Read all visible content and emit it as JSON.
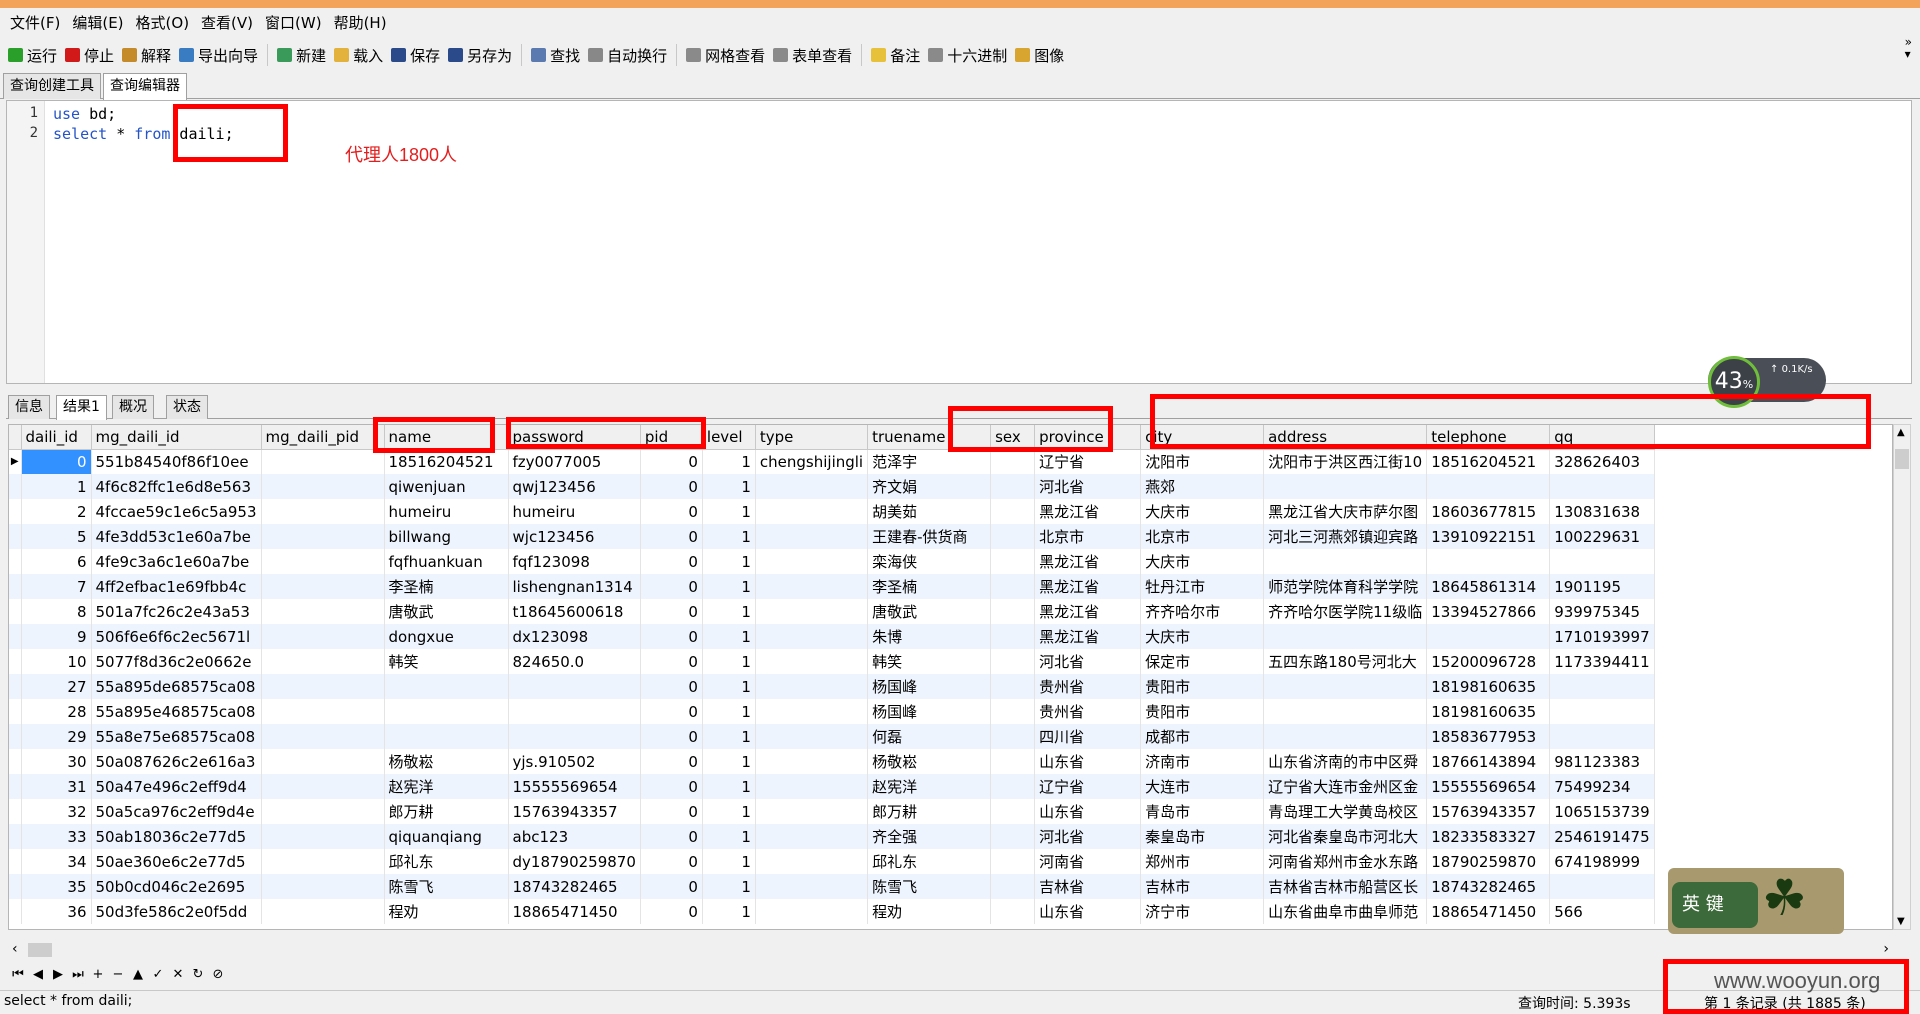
{
  "menu": [
    "文件(F)",
    "编辑(E)",
    "格式(O)",
    "查看(V)",
    "窗口(W)",
    "帮助(H)"
  ],
  "toolbar": {
    "groups": [
      [
        {
          "label": "运行",
          "icon": "run-icon",
          "color": "#2aa02a"
        },
        {
          "label": "停止",
          "icon": "stop-icon",
          "color": "#d21919"
        },
        {
          "label": "解释",
          "icon": "explain-icon",
          "color": "#c58a2a"
        },
        {
          "label": "导出向导",
          "icon": "export-icon",
          "color": "#3a7cc2"
        }
      ],
      [
        {
          "label": "新建",
          "icon": "new-icon",
          "color": "#3a9a5a"
        },
        {
          "label": "载入",
          "icon": "load-icon",
          "color": "#e3b23c"
        },
        {
          "label": "保存",
          "icon": "save-icon",
          "color": "#2a4a8a"
        },
        {
          "label": "另存为",
          "icon": "save-as-icon",
          "color": "#2a4a8a"
        }
      ],
      [
        {
          "label": "查找",
          "icon": "find-icon",
          "color": "#5a7ab0"
        },
        {
          "label": "自动换行",
          "icon": "wrap-icon",
          "color": "#888888"
        }
      ],
      [
        {
          "label": "网格查看",
          "icon": "grid-icon",
          "color": "#8a8a8a"
        },
        {
          "label": "表单查看",
          "icon": "form-icon",
          "color": "#8a8a8a"
        }
      ],
      [
        {
          "label": "备注",
          "icon": "note-icon",
          "color": "#e8c13a"
        },
        {
          "label": "十六进制",
          "icon": "hex-icon",
          "color": "#8a8a8a"
        },
        {
          "label": "图像",
          "icon": "image-icon",
          "color": "#d9a531"
        }
      ]
    ]
  },
  "top_tabs": [
    "查询创建工具",
    "查询编辑器"
  ],
  "editor": {
    "lines": [
      {
        "n": "1",
        "kw": "use",
        "rest": " bd;"
      },
      {
        "n": "2",
        "kw": "select",
        "rest": " * ",
        "kw2": "from",
        "rest2": " daili;"
      }
    ],
    "annotation": "代理人1800人"
  },
  "result_tabs": [
    "信息",
    "结果1",
    "概况",
    "状态"
  ],
  "grid": {
    "columns": [
      "daili_id",
      "mg_daili_id",
      "mg_daili_pid",
      "name",
      "password",
      "pid",
      "level",
      "type",
      "truename",
      "sex",
      "province",
      "city",
      "address",
      "telephone",
      "qq"
    ],
    "rows": [
      [
        "0",
        "551b84540f86f10ee",
        "",
        "18516204521",
        "fzy0077005",
        "0",
        "1",
        "chengshijingli",
        "范泽宇",
        "",
        "辽宁省",
        "沈阳市",
        "沈阳市于洪区西江街10",
        "18516204521",
        "328626403"
      ],
      [
        "1",
        "4f6c82ffc1e6d8e563",
        "",
        "qiwenjuan",
        "qwj123456",
        "0",
        "1",
        "",
        "齐文娟",
        "",
        "河北省",
        "燕郊",
        "",
        "",
        ""
      ],
      [
        "2",
        "4fccae59c1e6c5a953",
        "",
        "humeiru",
        "humeiru",
        "0",
        "1",
        "",
        "胡美茹",
        "",
        "黑龙江省",
        "大庆市",
        "黑龙江省大庆市萨尔图",
        "18603677815",
        "130831638"
      ],
      [
        "5",
        "4fe3dd53c1e60a7be",
        "",
        "billwang",
        "wjc123456",
        "0",
        "1",
        "",
        "王建春-供货商",
        "",
        "北京市",
        "北京市",
        "河北三河燕郊镇迎宾路",
        "13910922151",
        "100229631"
      ],
      [
        "6",
        "4fe9c3a6c1e60a7be",
        "",
        "fqfhuankuan",
        "fqf123098",
        "0",
        "1",
        "",
        "栾海侠",
        "",
        "黑龙江省",
        "大庆市",
        "",
        "",
        ""
      ],
      [
        "7",
        "4ff2efbac1e69fbb4c",
        "",
        "李圣楠",
        "lishengnan1314",
        "0",
        "1",
        "",
        "李圣楠",
        "",
        "黑龙江省",
        "牡丹江市",
        "师范学院体育科学学院",
        "18645861314",
        "1901195"
      ],
      [
        "8",
        "501a7fc26c2e43a53",
        "",
        "唐敬武",
        "t18645600618",
        "0",
        "1",
        "",
        "唐敬武",
        "",
        "黑龙江省",
        "齐齐哈尔市",
        "齐齐哈尔医学院11级临",
        "13394527866",
        "939975345"
      ],
      [
        "9",
        "506f6e6f6c2ec5671l",
        "",
        "dongxue",
        "dx123098",
        "0",
        "1",
        "",
        "朱博",
        "",
        "黑龙江省",
        "大庆市",
        "",
        "",
        "1710193997"
      ],
      [
        "10",
        "5077f8d36c2e0662e",
        "",
        "韩笑",
        "824650.0",
        "0",
        "1",
        "",
        "韩笑",
        "",
        "河北省",
        "保定市",
        "五四东路180号河北大",
        "15200096728",
        "1173394411"
      ],
      [
        "27",
        "55a895de68575ca08",
        "",
        "",
        "",
        "0",
        "1",
        "",
        "杨国峰",
        "",
        "贵州省",
        "贵阳市",
        "",
        "18198160635",
        ""
      ],
      [
        "28",
        "55a895e468575ca08",
        "",
        "",
        "",
        "0",
        "1",
        "",
        "杨国峰",
        "",
        "贵州省",
        "贵阳市",
        "",
        "18198160635",
        ""
      ],
      [
        "29",
        "55a8e75e68575ca08",
        "",
        "",
        "",
        "0",
        "1",
        "",
        "何磊",
        "",
        "四川省",
        "成都市",
        "",
        "18583677953",
        ""
      ],
      [
        "30",
        "50a087626c2e616a3",
        "",
        "杨敬崧",
        "yjs.910502",
        "0",
        "1",
        "",
        "杨敬崧",
        "",
        "山东省",
        "济南市",
        "山东省济南的市中区舜",
        "18766143894",
        "981123383"
      ],
      [
        "31",
        "50a47e496c2eff9d4",
        "",
        "赵宪洋",
        "15555569654",
        "0",
        "1",
        "",
        "赵宪洋",
        "",
        "辽宁省",
        "大连市",
        "辽宁省大连市金州区金",
        "15555569654",
        "75499234"
      ],
      [
        "32",
        "50a5ca976c2eff9d4e",
        "",
        "郎万耕",
        "15763943357",
        "0",
        "1",
        "",
        "郎万耕",
        "",
        "山东省",
        "青岛市",
        "青岛理工大学黄岛校区",
        "15763943357",
        "1065153739"
      ],
      [
        "33",
        "50ab18036c2e77d5",
        "",
        "qiquanqiang",
        "abc123",
        "0",
        "1",
        "",
        "齐全强",
        "",
        "河北省",
        "秦皇岛市",
        "河北省秦皇岛市河北大",
        "18233583327",
        "2546191475"
      ],
      [
        "34",
        "50ae360e6c2e77d5",
        "",
        "邱礼东",
        "dy18790259870",
        "0",
        "1",
        "",
        "邱礼东",
        "",
        "河南省",
        "郑州市",
        "河南省郑州市金水东路",
        "18790259870",
        "674198999"
      ],
      [
        "35",
        "50b0cd046c2e2695",
        "",
        "陈雪飞",
        "18743282465",
        "0",
        "1",
        "",
        "陈雪飞",
        "",
        "吉林省",
        "吉林市",
        "吉林省吉林市船营区长",
        "18743282465",
        ""
      ],
      [
        "36",
        "50d3fe586c2e0f5dd",
        "",
        "程劝",
        "18865471450",
        "0",
        "1",
        "",
        "程劝",
        "",
        "山东省",
        "济宁市",
        "山东省曲阜市曲阜师范",
        "18865471450",
        "566"
      ]
    ]
  },
  "nav_buttons": [
    {
      "glyph": "⏮",
      "icon": "first-record-icon"
    },
    {
      "glyph": "◀",
      "icon": "prev-record-icon"
    },
    {
      "glyph": "▶",
      "icon": "next-record-icon"
    },
    {
      "glyph": "⏭",
      "icon": "last-record-icon"
    },
    {
      "glyph": "+",
      "icon": "add-record-icon"
    },
    {
      "glyph": "−",
      "icon": "delete-record-icon"
    },
    {
      "glyph": "▲",
      "icon": "up-icon"
    },
    {
      "glyph": "✓",
      "icon": "apply-icon"
    },
    {
      "glyph": "✕",
      "icon": "cancel-edit-icon"
    },
    {
      "glyph": "↻",
      "icon": "refresh-icon"
    },
    {
      "glyph": "⊘",
      "icon": "stop-refresh-icon"
    }
  ],
  "status": {
    "sql": "select * from daili;",
    "query_time": "查询时间: 5.393s",
    "record": "第 1 条记录 (共 1885 条)"
  },
  "watermark": "www.wooyun.org",
  "speed_widget": {
    "percent": "43",
    "unit": "%",
    "up": "0.1K/s"
  },
  "ime": {
    "label": "英 键"
  }
}
